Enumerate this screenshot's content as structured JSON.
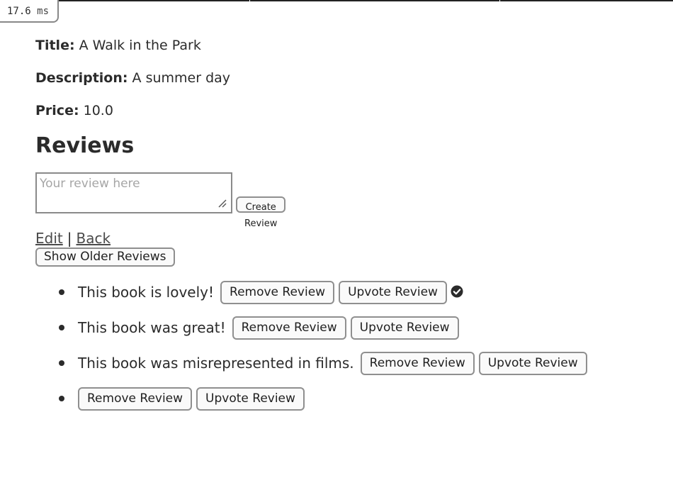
{
  "perf": {
    "value": "17.6",
    "unit": "ms"
  },
  "book": {
    "title_label": "Title:",
    "title": "A Walk in the Park",
    "description_label": "Description:",
    "description": "A summer day",
    "price_label": "Price:",
    "price": "10.0"
  },
  "reviews": {
    "heading": "Reviews",
    "input_placeholder": "Your review here",
    "create_label": "Create Review",
    "edit_link": "Edit",
    "separator": "|",
    "back_link": "Back",
    "show_older_label": "Show Older Reviews",
    "items": [
      {
        "text": "This book is lovely!",
        "remove_label": "Remove Review",
        "upvote_label": "Upvote Review",
        "upvoted": true
      },
      {
        "text": "This book was great!",
        "remove_label": "Remove Review",
        "upvote_label": "Upvote Review",
        "upvoted": false
      },
      {
        "text": "This book was misrepresented in films.",
        "remove_label": "Remove Review",
        "upvote_label": "Upvote Review",
        "upvoted": false
      },
      {
        "text": "",
        "remove_label": "Remove Review",
        "upvote_label": "Upvote Review",
        "upvoted": false
      }
    ]
  },
  "icons": {
    "upvoted": "check-circle-icon"
  },
  "colors": {
    "text": "#2b2b2b",
    "border": "#8f8f8f",
    "placeholder": "#a6a6a6"
  }
}
